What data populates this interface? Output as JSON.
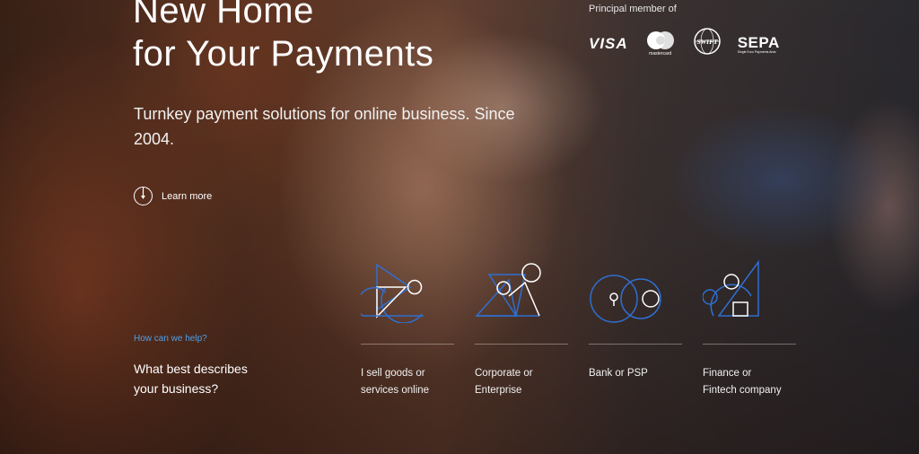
{
  "hero": {
    "title_line1": "New Home",
    "title_line2": "for Your Payments",
    "subtitle": "Turnkey payment solutions for online business. Since 2004.",
    "learn_more": "Learn more"
  },
  "membership": {
    "label": "Principal member of",
    "brands": {
      "visa": "VISA",
      "mastercard": "mastercard",
      "swift": "SWIFT",
      "sepa": "SEPA",
      "sepa_sub": "Single Euro Payments Area"
    }
  },
  "help": {
    "label": "How can we help?",
    "question_line1": "What best describes",
    "question_line2": "your business?"
  },
  "options": [
    {
      "line1": "I sell goods or",
      "line2": "services online",
      "icon": "merchant-geometric-icon"
    },
    {
      "line1": "Corporate or",
      "line2": "Enterprise",
      "icon": "corporate-geometric-icon"
    },
    {
      "line1": "Bank or PSP",
      "line2": "",
      "icon": "bank-geometric-icon"
    },
    {
      "line1": "Finance or",
      "line2": "Fintech company",
      "icon": "fintech-geometric-icon"
    }
  ],
  "colors": {
    "accent": "#4ea0e8",
    "icon_blue": "#2f6fd0",
    "text": "#ffffff"
  }
}
